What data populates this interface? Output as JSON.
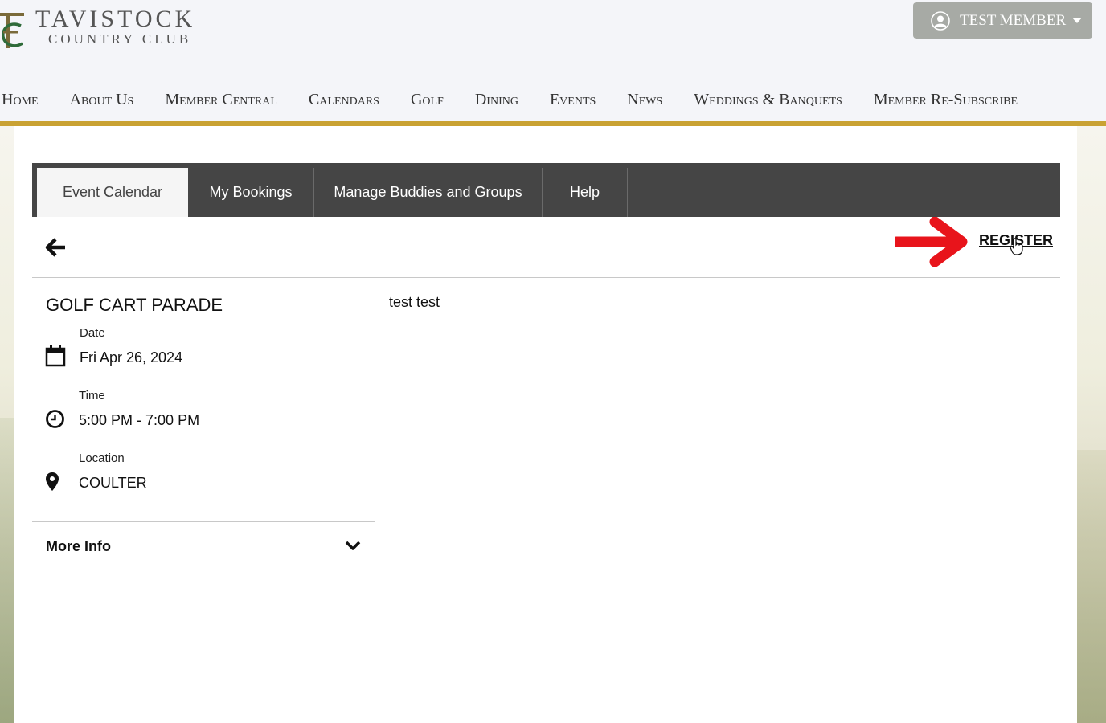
{
  "brand": {
    "name_line1": "TAVISTOCK",
    "name_line2": "COUNTRY CLUB",
    "accent_gold": "#c9a233",
    "logo_green": "#2f6b3a"
  },
  "user_menu": {
    "label": "TEST MEMBER",
    "icon": "user-circle-icon"
  },
  "nav": {
    "items": [
      "Home",
      "About Us",
      "Member Central",
      "Calendars",
      "Golf",
      "Dining",
      "Events",
      "News",
      "Weddings & Banquets",
      "Member Re-Subscribe"
    ]
  },
  "tabs": {
    "items": [
      {
        "label": "Event Calendar",
        "active": true
      },
      {
        "label": "My Bookings",
        "active": false
      },
      {
        "label": "Manage Buddies and Groups",
        "active": false
      },
      {
        "label": "Help",
        "active": false
      }
    ],
    "background": "#454545"
  },
  "actions": {
    "back_icon": "arrow-left-icon",
    "register_label": "REGISTER",
    "annotation_color": "#e8141b"
  },
  "event": {
    "title": "GOLF CART PARADE",
    "date_label": "Date",
    "date_value": "Fri Apr 26, 2024",
    "time_label": "Time",
    "time_value": "5:00 PM - 7:00 PM",
    "location_label": "Location",
    "location_value": "COULTER",
    "description": "test test",
    "more_info_label": "More Info"
  }
}
